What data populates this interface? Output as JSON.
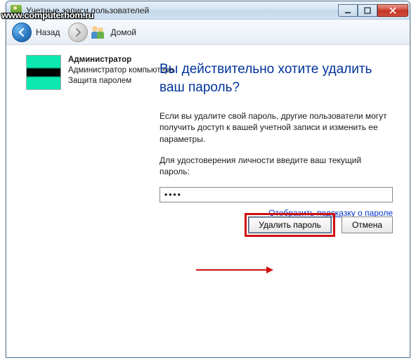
{
  "window": {
    "title": "Учетные записи пользователей"
  },
  "nav": {
    "back_label": "Назад",
    "home_label": "Домой"
  },
  "user": {
    "name": "Администратор",
    "role": "Администратор компьютера",
    "protection": "Защита паролем"
  },
  "main": {
    "heading": "Вы действительно хотите удалить ваш пароль?",
    "warning": "Если вы удалите свой пароль, другие пользователи могут получить доступ к вашей учетной записи и изменить ее параметры.",
    "prompt": "Для удостоверения личности введите ваш текущий пароль:",
    "password_value": "••••",
    "hint_link": "Отобразить подсказку о пароле"
  },
  "buttons": {
    "delete": "Удалить пароль",
    "cancel": "Отмена"
  },
  "watermark": "www.computerhom.ru"
}
